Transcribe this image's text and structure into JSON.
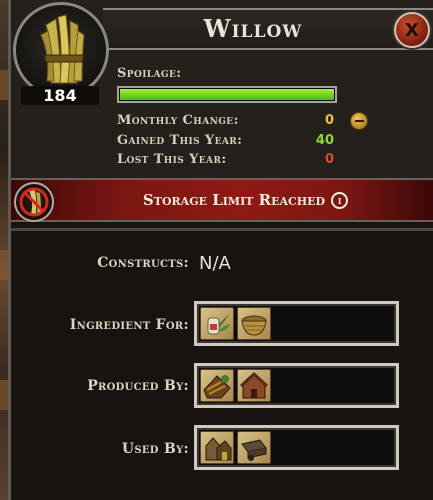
{
  "header": {
    "title": "Willow",
    "close_label": "X",
    "resource_count": "184"
  },
  "stats": {
    "spoilage_label": "Spoilage:",
    "spoilage_level": 1.0,
    "monthly_change_label": "Monthly Change:",
    "monthly_change_value": "0",
    "gained_label": "Gained This Year:",
    "gained_value": "40",
    "lost_label": "Lost This Year:",
    "lost_value": "0"
  },
  "banner": {
    "text": "Storage Limit Reached",
    "info_glyph": "i"
  },
  "details": {
    "constructs_label": "Constructs:",
    "constructs_value": "N/A",
    "ingredient_label": "Ingredient For:",
    "produced_label": "Produced By:",
    "used_label": "Used By:"
  },
  "icons": {
    "portrait": "willow-bundle-icon",
    "banner": "no-willow-icon",
    "ingredient_slots": [
      "herbal-remedy-icon",
      "basket-icon"
    ],
    "produced_slots": [
      "lumber-hut-icon",
      "woodcutter-icon"
    ],
    "used_slots": [
      "workshop-icon",
      "cart-icon"
    ]
  },
  "colors": {
    "title": "#eae4d8",
    "spoilage_bar": "#6fd422",
    "monthly_change": "#f0c030",
    "gained": "#8ad830",
    "lost": "#e24a2a",
    "banner": "#8f1a14"
  }
}
